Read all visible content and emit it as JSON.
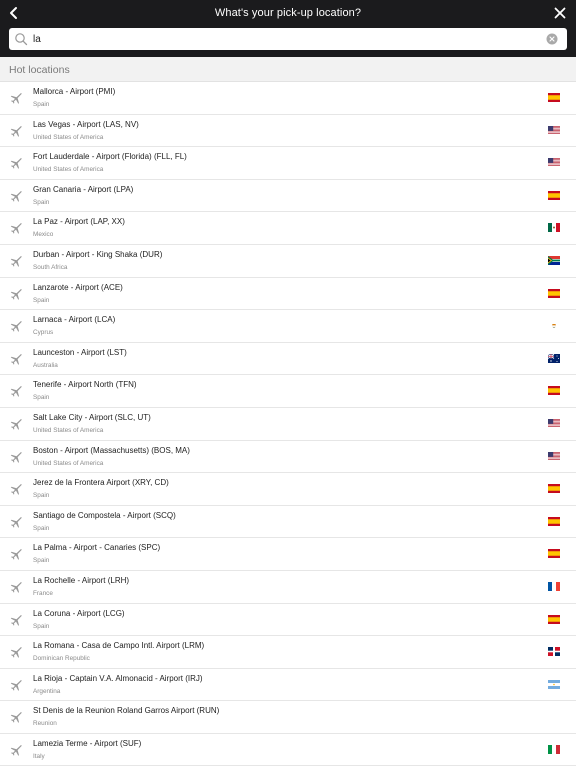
{
  "header": {
    "title": "What's your pick-up location?",
    "back_icon": "chevron-left-icon",
    "close_icon": "close-icon"
  },
  "search": {
    "value": "la",
    "placeholder": "",
    "search_icon": "search-icon",
    "clear_icon": "clear-icon"
  },
  "section": {
    "title": "Hot locations"
  },
  "colors": {
    "topbar": "#1b1b1d",
    "background": "#ffffff",
    "muted_text": "#8b8b8b"
  },
  "locations": [
    {
      "name": "Mallorca - Airport (PMI)",
      "country": "Spain",
      "flag": "es"
    },
    {
      "name": "Las Vegas - Airport (LAS, NV)",
      "country": "United States of America",
      "flag": "us"
    },
    {
      "name": "Fort Lauderdale - Airport (Florida) (FLL, FL)",
      "country": "United States of America",
      "flag": "us"
    },
    {
      "name": "Gran Canaria - Airport (LPA)",
      "country": "Spain",
      "flag": "es"
    },
    {
      "name": "La Paz - Airport (LAP, XX)",
      "country": "Mexico",
      "flag": "mx"
    },
    {
      "name": "Durban - Airport - King Shaka (DUR)",
      "country": "South Africa",
      "flag": "za"
    },
    {
      "name": "Lanzarote - Airport (ACE)",
      "country": "Spain",
      "flag": "es"
    },
    {
      "name": "Larnaca - Airport (LCA)",
      "country": "Cyprus",
      "flag": "cy"
    },
    {
      "name": "Launceston - Airport (LST)",
      "country": "Australia",
      "flag": "au"
    },
    {
      "name": "Tenerife - Airport North (TFN)",
      "country": "Spain",
      "flag": "es"
    },
    {
      "name": "Salt Lake City - Airport (SLC, UT)",
      "country": "United States of America",
      "flag": "us"
    },
    {
      "name": "Boston - Airport (Massachusetts) (BOS, MA)",
      "country": "United States of America",
      "flag": "us"
    },
    {
      "name": "Jerez de la Frontera Airport (XRY, CD)",
      "country": "Spain",
      "flag": "es"
    },
    {
      "name": "Santiago de Compostela - Airport (SCQ)",
      "country": "Spain",
      "flag": "es"
    },
    {
      "name": "La Palma - Airport - Canaries (SPC)",
      "country": "Spain",
      "flag": "es"
    },
    {
      "name": "La Rochelle - Airport (LRH)",
      "country": "France",
      "flag": "fr"
    },
    {
      "name": "La Coruna - Airport (LCG)",
      "country": "Spain",
      "flag": "es"
    },
    {
      "name": "La Romana - Casa de Campo Intl. Airport (LRM)",
      "country": "Dominican Republic",
      "flag": "do"
    },
    {
      "name": "La Rioja - Captain V.A. Almonacid - Airport (IRJ)",
      "country": "Argentina",
      "flag": "ar"
    },
    {
      "name": "St Denis de la Reunion Roland Garros Airport (RUN)",
      "country": "Reunion",
      "flag": ""
    },
    {
      "name": "Lamezia Terme - Airport (SUF)",
      "country": "Italy",
      "flag": "it"
    }
  ]
}
